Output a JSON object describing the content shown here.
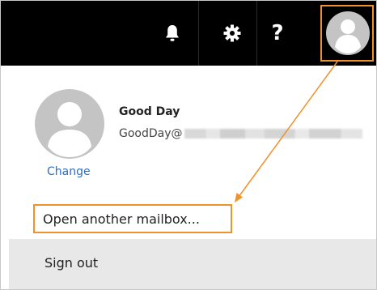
{
  "topbar": {
    "icons": [
      "bell-icon",
      "gear-icon",
      "help-icon",
      "avatar-icon"
    ],
    "help_label": "?"
  },
  "user": {
    "name": "Good Day",
    "email_prefix": "GoodDay@",
    "change_label": "Change"
  },
  "menu": {
    "open_mailbox_label": "Open another mailbox...",
    "sign_out_label": "Sign out"
  },
  "colors": {
    "topbar_bg": "#000000",
    "highlight": "#f0922b",
    "link": "#2a6fc9",
    "signout_bg": "#e8e8e8"
  }
}
